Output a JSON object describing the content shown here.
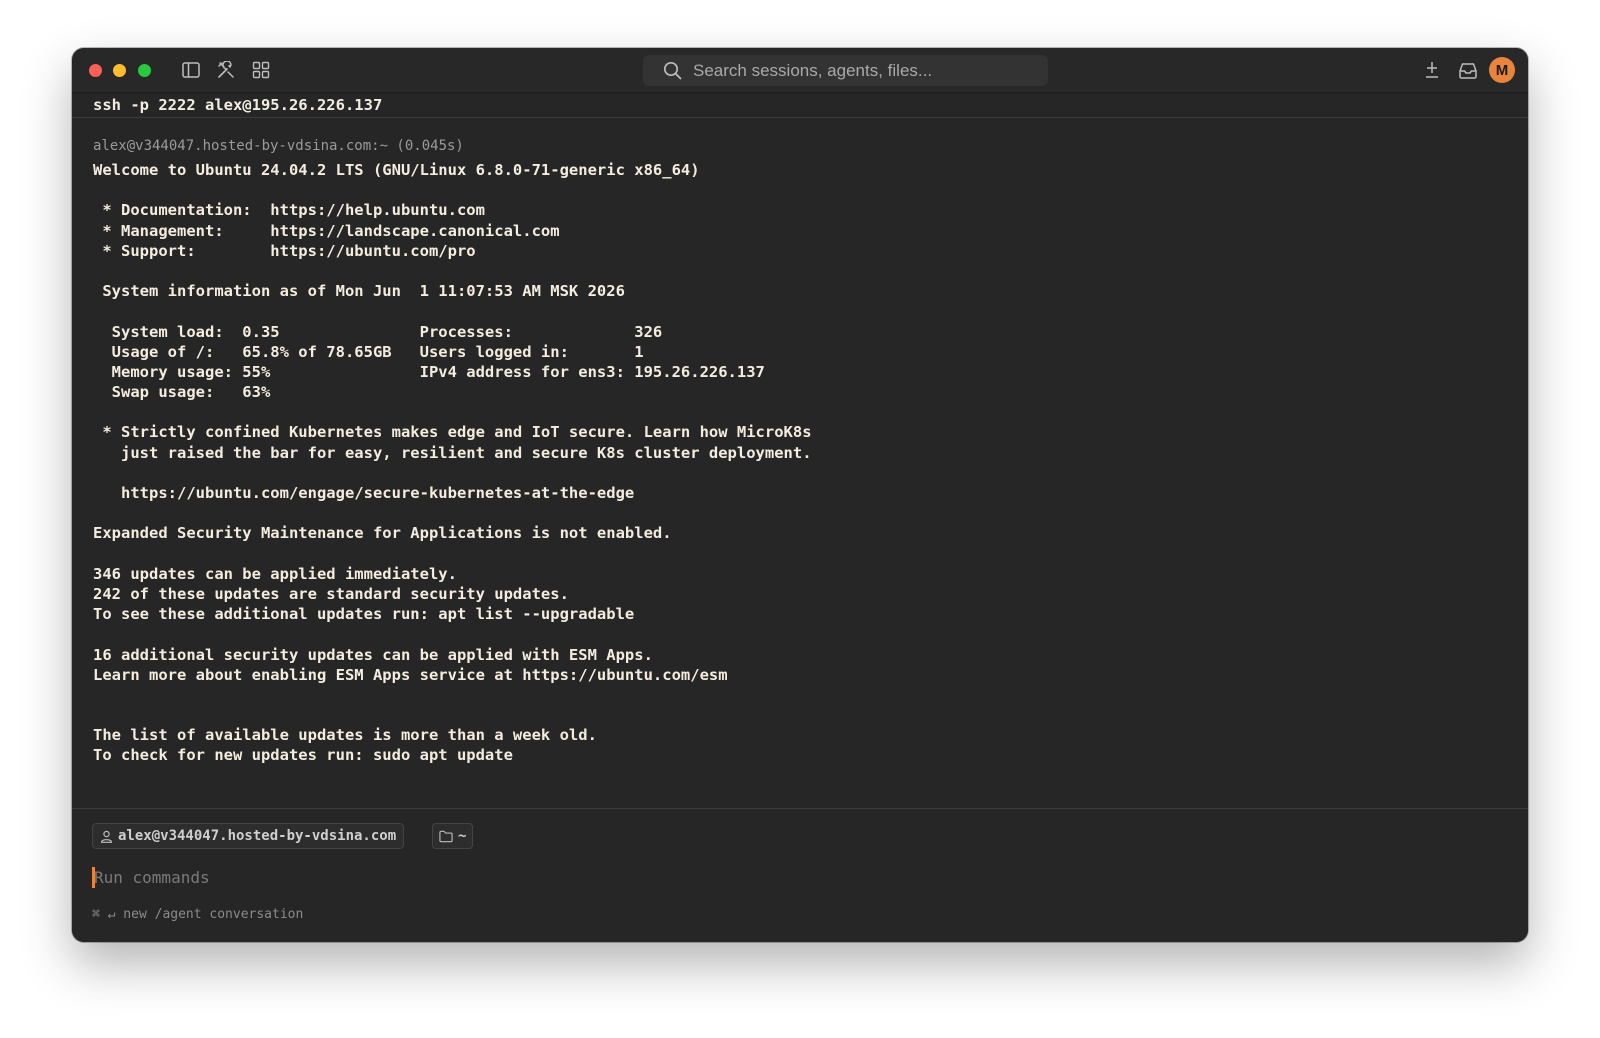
{
  "titlebar": {
    "search_placeholder": "Search sessions, agents, files...",
    "avatar_letter": "M",
    "accent_color": "#e9843c"
  },
  "session": {
    "command": "ssh -p 2222 alex@195.26.226.137",
    "prompt_meta": "alex@v344047.hosted-by-vdsina.com:~ (0.045s)"
  },
  "terminal": {
    "lines": [
      "Welcome to Ubuntu 24.04.2 LTS (GNU/Linux 6.8.0-71-generic x86_64)",
      "",
      " * Documentation:  https://help.ubuntu.com",
      " * Management:     https://landscape.canonical.com",
      " * Support:        https://ubuntu.com/pro",
      "",
      " System information as of Mon Jun  1 11:07:53 AM MSK 2026",
      "",
      "  System load:  0.35               Processes:             326",
      "  Usage of /:   65.8% of 78.65GB   Users logged in:       1",
      "  Memory usage: 55%                IPv4 address for ens3: 195.26.226.137",
      "  Swap usage:   63%",
      "",
      " * Strictly confined Kubernetes makes edge and IoT secure. Learn how MicroK8s",
      "   just raised the bar for easy, resilient and secure K8s cluster deployment.",
      "",
      "   https://ubuntu.com/engage/secure-kubernetes-at-the-edge",
      "",
      "Expanded Security Maintenance for Applications is not enabled.",
      "",
      "346 updates can be applied immediately.",
      "242 of these updates are standard security updates.",
      "To see these additional updates run: apt list --upgradable",
      "",
      "16 additional security updates can be applied with ESM Apps.",
      "Learn more about enabling ESM Apps service at https://ubuntu.com/esm",
      "",
      "",
      "The list of available updates is more than a week old.",
      "To check for new updates run: sudo apt update"
    ]
  },
  "input": {
    "user_chip": "alex@v344047.hosted-by-vdsina.com",
    "dir_chip": "~",
    "placeholder": "Run commands",
    "hint": "⌘ ↵ new /agent conversation"
  }
}
